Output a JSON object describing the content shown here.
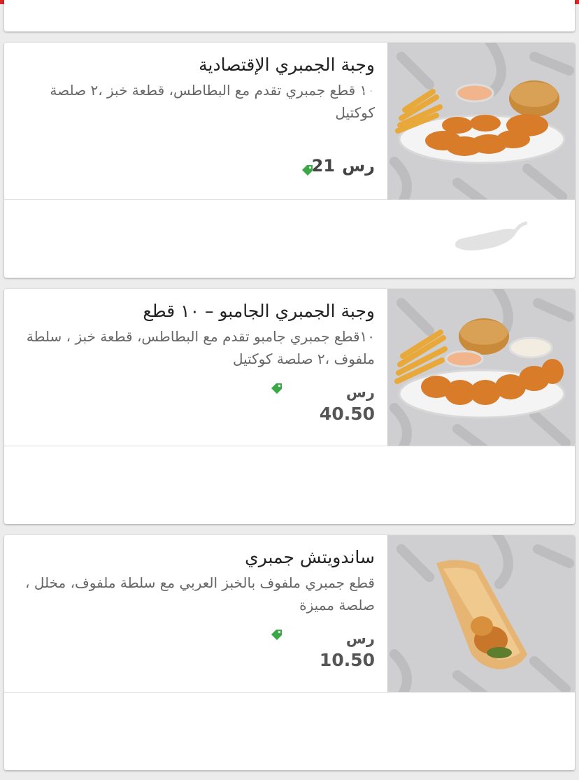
{
  "watermark": "m",
  "items": [
    {
      "title": "وجبة الجمبري الإقتصادية",
      "description": "١٠ قطع جمبري تقدم مع البطاطس، قطعة خبز ،٢ صلصة كوكتيل",
      "currency": "رس",
      "price": "21"
    },
    {
      "title": "وجبة الجمبري الجامبو – ١٠ قطع",
      "description": "١٠قطع جمبري جامبو تقدم مع البطاطس، قطعة خبز ، سلطة ملفوف ،٢ صلصة كوكتيل",
      "currency": "رس",
      "price": "40.50"
    },
    {
      "title": "ساندويتش جمبري",
      "description": "قطع جمبري ملفوف بالخبز العربي مع سلطة ملفوف، مخلل ، صلصة مميزة",
      "currency": "رس",
      "price": "10.50"
    }
  ],
  "icons": {
    "price_tag": "price-tag-icon",
    "spice_level": "chili-pepper-icon"
  },
  "colors": {
    "brand_red": "#d8262c",
    "tag_green": "#3aa845",
    "thumb_bg": "#cfcfd1"
  }
}
